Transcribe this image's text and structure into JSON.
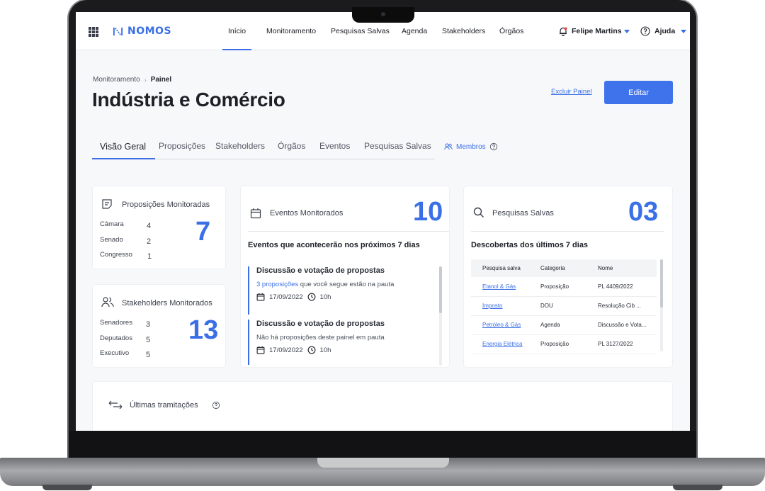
{
  "app": {
    "name": "NOMOS",
    "accent": "#3a6fe6"
  },
  "topnav": {
    "items": [
      "Início",
      "Monitoramento",
      "Pesquisas Salvas",
      "Agenda",
      "Stakeholders",
      "Órgãos"
    ],
    "active": "Início",
    "user": "Felipe Martins",
    "help": "Ajuda"
  },
  "header": {
    "breadcrumb": [
      "Monitoramento",
      "Painel"
    ],
    "title": "Indústria e Comércio",
    "delete_link": "Excluir Painel",
    "edit_button": "Editar"
  },
  "tabs": {
    "items": [
      "Visão Geral",
      "Proposições",
      "Stakeholders",
      "Órgãos",
      "Eventos",
      "Pesquisas Salvas"
    ],
    "active": "Visão Geral",
    "members": "Membros"
  },
  "proposicoes": {
    "title": "Proposições Monitoradas",
    "total": "7",
    "rows": [
      {
        "label": "Câmara",
        "value": "4"
      },
      {
        "label": "Senado",
        "value": "2"
      },
      {
        "label": "Congresso",
        "value": "1"
      }
    ]
  },
  "stakeholders": {
    "title": "Stakeholders Monitorados",
    "total": "13",
    "rows": [
      {
        "label": "Senadores",
        "value": "3"
      },
      {
        "label": "Deputados",
        "value": "5"
      },
      {
        "label": "Executivo",
        "value": "5"
      }
    ]
  },
  "eventos": {
    "title": "Eventos Monitorados",
    "total": "10",
    "subtitle": "Eventos que acontecerão nos próximos 7 dias",
    "items": [
      {
        "title": "Discussão e votação de propostas",
        "link": "3 proposições",
        "desc": " que você segue estão na pauta",
        "date": "17/09/2022",
        "time": "10h"
      },
      {
        "title": "Discussão e votação de propostas",
        "link": "",
        "desc": "Não há proposições deste painel em pauta",
        "date": "17/09/2022",
        "time": "10h"
      }
    ]
  },
  "pesquisas": {
    "title": "Pesquisas Salvas",
    "total": "03",
    "subtitle": "Descobertas dos últimos 7 dias",
    "columns": [
      "Pesquisa salva",
      "Categoria",
      "Nome"
    ],
    "rows": [
      [
        "Etanol & Gás",
        "Proposição",
        "PL 4409/2022"
      ],
      [
        "Imposto",
        "DOU",
        "Resolução Cib ..."
      ],
      [
        "Petróleo & Gás",
        "Agenda",
        "Discussão e Vota..."
      ],
      [
        "Energia Elétrica",
        "Proposição",
        "PL 3127/2022"
      ]
    ]
  },
  "tramitacoes": {
    "title": "Últimas tramitações"
  }
}
